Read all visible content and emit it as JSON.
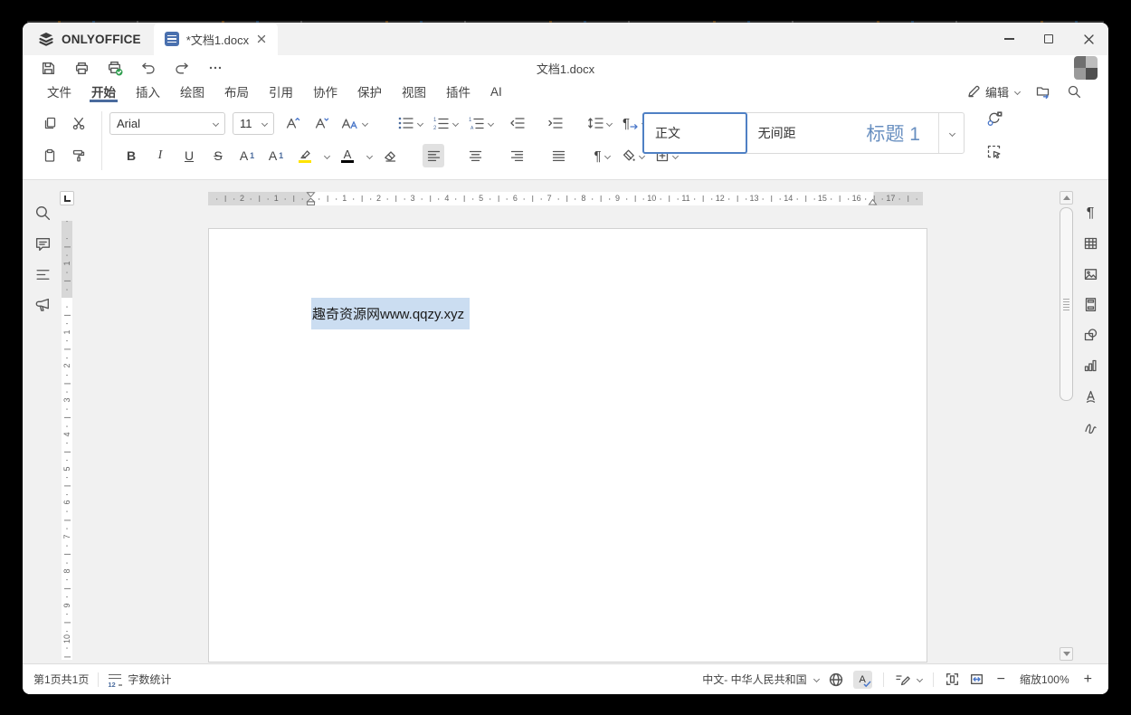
{
  "app": {
    "brand": "ONLYOFFICE",
    "tab_title": "*文档1.docx",
    "doc_title": "文档1.docx"
  },
  "menu": {
    "items": [
      "文件",
      "开始",
      "插入",
      "绘图",
      "布局",
      "引用",
      "协作",
      "保护",
      "视图",
      "插件",
      "AI"
    ],
    "edit_label": "编辑"
  },
  "toolbar": {
    "font_name": "Arial",
    "font_size": "11",
    "glyphs": {
      "bold": "B",
      "italic": "I",
      "underline": "U",
      "strike": "S",
      "sup_letter": "A",
      "sup_digit": "1",
      "sub_letter": "A",
      "sub_digit": "1",
      "font_color_letter": "A",
      "para_mark": "¶",
      "para_dir_mark": "¶"
    },
    "styles": {
      "normal": "正文",
      "no_spacing": "无间距",
      "heading1": "标题 1"
    }
  },
  "document": {
    "selected_text": "趣奇资源网www.qqzy.xyz"
  },
  "ruler": {
    "h_left": [
      "2",
      "1"
    ],
    "h_main": [
      "1",
      "2",
      "3",
      "4",
      "5",
      "6",
      "7",
      "8",
      "9",
      "10",
      "11",
      "12",
      "13",
      "14",
      "15",
      "16"
    ],
    "h_right": [
      "17"
    ],
    "v_top": [
      "1"
    ],
    "v_main": [
      "1",
      "2",
      "3",
      "4",
      "5",
      "6",
      "7",
      "8",
      "9",
      "10"
    ]
  },
  "right_panel": {
    "para_mark": "¶"
  },
  "statusbar": {
    "page_info": "第1页共1页",
    "word_count": "字数统计",
    "word_count_badge": "12",
    "language": "中文- 中华人民共和国",
    "spell_letter": "A",
    "zoom_label": "缩放100%"
  },
  "colors": {
    "accent_blue": "#4a6b9d",
    "style_border_blue": "#4f80c4",
    "heading_blue": "#688fc0",
    "selection_blue": "#cbddf1",
    "highlight_yellow": "#ffe400",
    "check_green": "#2f9e4f"
  }
}
